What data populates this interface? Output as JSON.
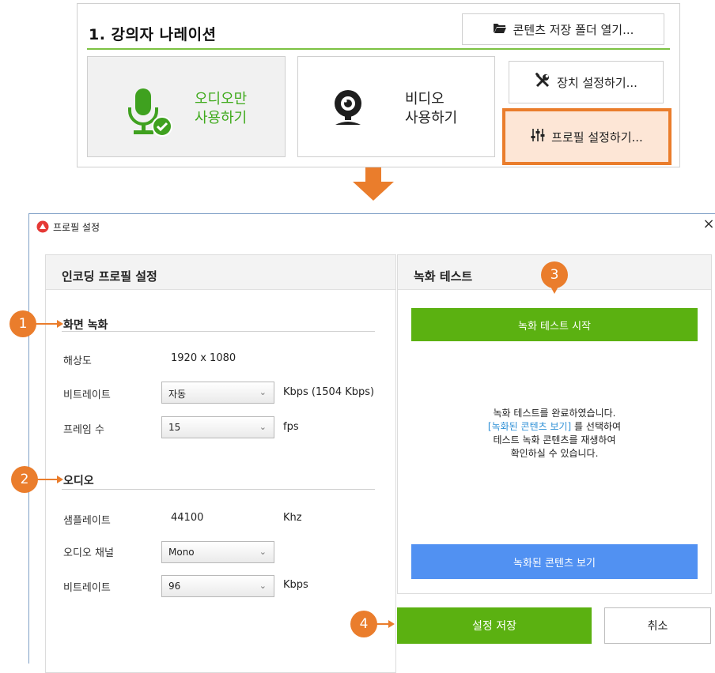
{
  "narration": {
    "title": "1. 강의자 나레이션",
    "open_folder_button": "콘텐츠 저장 폴더 열기...",
    "audio_only_card": "오디오만\n사용하기",
    "video_card": "비디오\n사용하기",
    "device_settings_button": "장치 설정하기...",
    "profile_settings_button": "프로필 설정하기..."
  },
  "dialog": {
    "title": "프로필 설정",
    "close": "×",
    "encoding_profile": {
      "header": "인코딩 프로필 설정",
      "screen_recording": {
        "title": "화면 녹화",
        "resolution_label": "해상도",
        "resolution_value": "1920 x 1080",
        "bitrate_label": "비트레이트",
        "bitrate_value": "자동",
        "bitrate_unit": "Kbps  (1504 Kbps)",
        "framerate_label": "프레임 수",
        "framerate_value": "15",
        "framerate_unit": "fps"
      },
      "audio": {
        "title": "오디오",
        "samplerate_label": "샘플레이트",
        "samplerate_value": "44100",
        "samplerate_unit": "Khz",
        "channel_label": "오디오 채널",
        "channel_value": "Mono",
        "bitrate_label": "비트레이트",
        "bitrate_value": "96",
        "bitrate_unit": "Kbps"
      }
    },
    "recording_test": {
      "header": "녹화 테스트",
      "start_button": "녹화 테스트 시작",
      "message_line1": "녹화 테스트를 완료하였습니다.",
      "message_link": "[녹화된 콘텐츠 보기]",
      "message_line2_rest": " 를 선택하여",
      "message_line3": "테스트 녹화 콘텐츠를 재생하여",
      "message_line4": "확인하실 수 있습니다.",
      "view_button": "녹화된 콘텐츠 보기"
    },
    "save_button": "설정 저장",
    "cancel_button": "취소"
  },
  "callouts": [
    "1",
    "2",
    "3",
    "4"
  ],
  "colors": {
    "accent_orange": "#ea7d2c",
    "green": "#5bb111",
    "blue": "#5191f2",
    "link": "#2d8fd6"
  },
  "icons": [
    "folder-open-icon",
    "microphone-check-icon",
    "webcam-icon",
    "tools-icon",
    "sliders-icon",
    "app-logo-icon",
    "close-icon",
    "chevron-down-icon",
    "arrow-down-icon"
  ]
}
